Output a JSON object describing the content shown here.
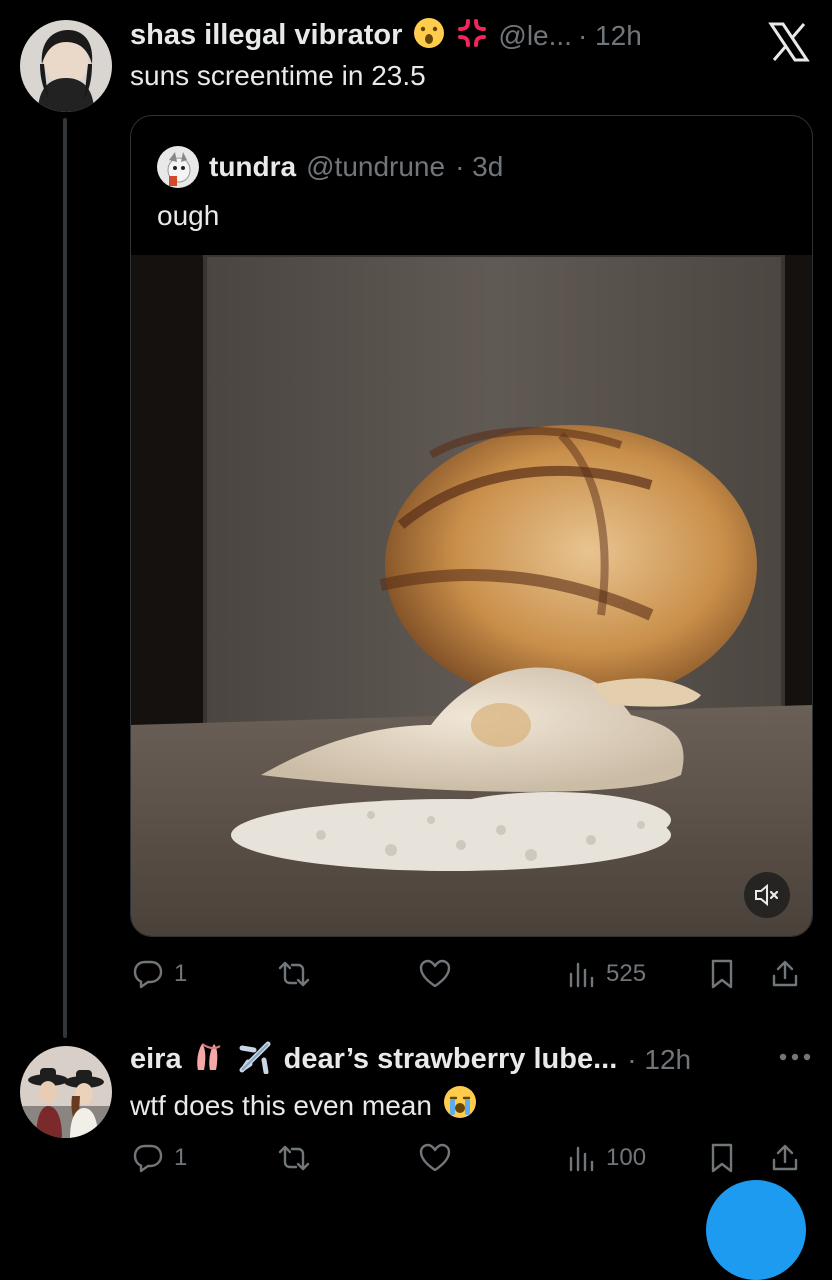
{
  "post1": {
    "display_name": "shas illegal vibrator",
    "handle": "@le...",
    "time": "· 12h",
    "text": "suns screentime in 23.5",
    "actions": {
      "reply": "1",
      "repost": "",
      "like": "",
      "views": "525"
    }
  },
  "quote": {
    "display_name": "tundra",
    "handle": "@tundrune",
    "time": "· 3d",
    "text": "ough",
    "media": {
      "muted": true
    }
  },
  "post2": {
    "display_name": "eira",
    "handle_or_rest": "dear’s strawberry lube...",
    "time": "· 12h",
    "text": "wtf does this even mean",
    "actions": {
      "reply": "1",
      "repost": "",
      "like": "",
      "views": "100"
    }
  },
  "icons": {
    "brand": "x-logo-icon",
    "more": "more-icon",
    "reply": "reply-icon",
    "repost": "repost-icon",
    "like": "heart-icon",
    "views": "views-icon",
    "bookmark": "bookmark-icon",
    "share": "share-icon",
    "mute": "muted-speaker-icon"
  },
  "colors": {
    "background": "#000000",
    "text": "#e7e9ea",
    "muted": "#71767b",
    "accent": "#1d9bf0"
  }
}
